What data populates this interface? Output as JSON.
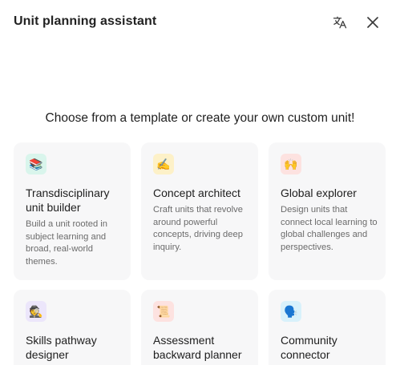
{
  "header": {
    "title": "Unit planning assistant",
    "translate_icon": "translate-icon",
    "close_icon": "close-icon"
  },
  "prompt": "Choose from a template or create your own custom unit!",
  "cards": [
    {
      "title": "Transdisciplinary unit builder",
      "description": "Build a unit rooted in subject learning and broad, real-world themes.",
      "icon": "books-icon",
      "glyph": "📚",
      "icon_bg": "#d9f5ec"
    },
    {
      "title": "Concept architect",
      "description": "Craft units that revolve around powerful concepts, driving deep inquiry.",
      "icon": "writing-hand-icon",
      "glyph": "✍️",
      "icon_bg": "#fdf1c8"
    },
    {
      "title": "Global explorer",
      "description": "Design units that connect local learning to global challenges and perspectives.",
      "icon": "globe-hands-icon",
      "glyph": "🙌",
      "icon_bg": "#fde2e0"
    },
    {
      "title": "Skills pathway designer",
      "description": "",
      "icon": "detective-icon",
      "glyph": "🕵️",
      "icon_bg": "#ece6fb"
    },
    {
      "title": "Assessment backward planner",
      "description": "",
      "icon": "scroll-icon",
      "glyph": "📜",
      "icon_bg": "#fde2e0"
    },
    {
      "title": "Community connector",
      "description": "",
      "icon": "speech-bubble-icon",
      "glyph": "🗣️",
      "icon_bg": "#d8f1fb"
    }
  ]
}
